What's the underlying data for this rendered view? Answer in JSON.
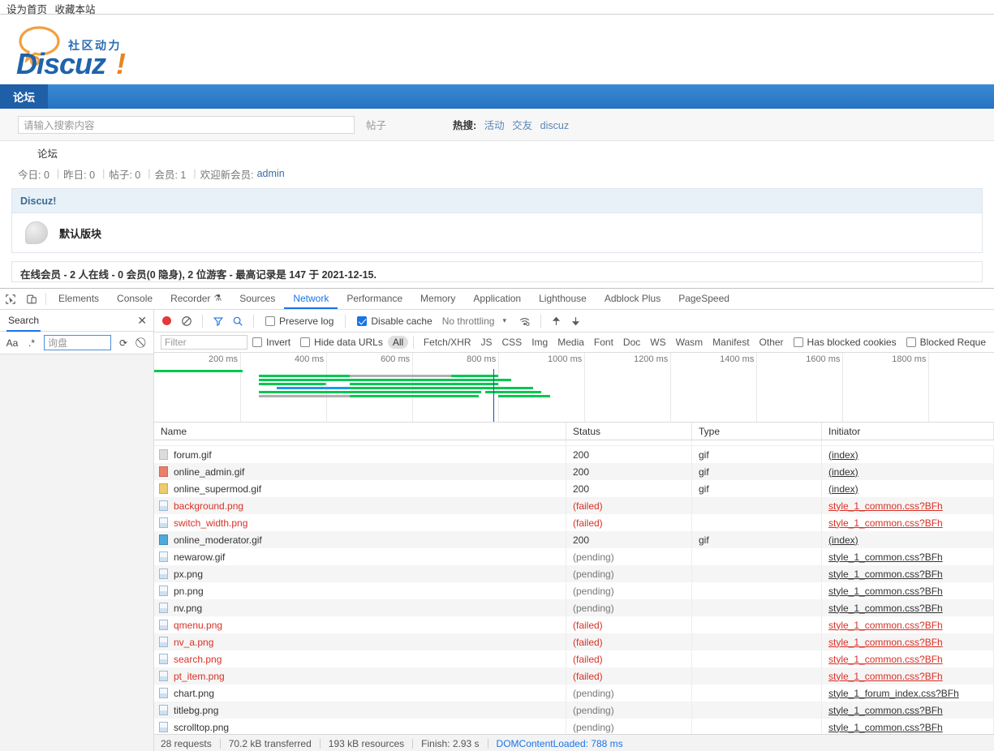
{
  "browser": {
    "topbar_links": [
      "设为首页",
      "收藏本站"
    ],
    "logo": {
      "tagline": "社区动力",
      "wordmark": "Discuz",
      "bang": "!"
    },
    "nav": {
      "tab": "论坛"
    },
    "search": {
      "placeholder": "请输入搜索内容",
      "scope": "帖子",
      "hot_label": "热搜:",
      "hot_links": [
        "活动",
        "交友",
        "discuz"
      ]
    },
    "breadcrumb": "论坛",
    "stats": {
      "today_label": "今日: 0",
      "yesterday_label": "昨日: 0",
      "posts_label": "帖子: 0",
      "members_label": "会员: 1",
      "welcome_label": "欢迎新会员:",
      "newest_member": "admin"
    },
    "forum_block": {
      "title": "Discuz!",
      "board_name": "默认版块"
    },
    "online_text": "在线会员 - 2 人在线 - 0 会员(0 隐身), 2 位游客 - 最高记录是 147 于 2021-12-15."
  },
  "devtools": {
    "tabs": [
      {
        "label": "Elements",
        "active": false
      },
      {
        "label": "Console",
        "active": false
      },
      {
        "label": "Recorder",
        "active": false,
        "badge": "⚗"
      },
      {
        "label": "Sources",
        "active": false
      },
      {
        "label": "Network",
        "active": true
      },
      {
        "label": "Performance",
        "active": false
      },
      {
        "label": "Memory",
        "active": false
      },
      {
        "label": "Application",
        "active": false
      },
      {
        "label": "Lighthouse",
        "active": false
      },
      {
        "label": "Adblock Plus",
        "active": false
      },
      {
        "label": "PageSpeed",
        "active": false
      }
    ],
    "search_panel": {
      "title": "Search",
      "close": "✕",
      "match_case": "Aa",
      "regex": ".*",
      "query": "询盘",
      "refresh_icon": "⟳",
      "clear_icon": "⃠"
    },
    "network_toolbar": {
      "record_title": "record",
      "clear_icon": "⃠",
      "filter_icon": "filter",
      "search_icon": "⌕",
      "preserve_log": {
        "label": "Preserve log",
        "checked": false
      },
      "disable_cache": {
        "label": "Disable cache",
        "checked": true
      },
      "throttling": "No throttling",
      "caret": "▾",
      "wifi_icon": "wifi",
      "import_icon": "⬆",
      "export_icon": "⬇"
    },
    "filter_bar": {
      "filter_placeholder": "Filter",
      "invert": {
        "label": "Invert",
        "checked": false
      },
      "hide_data_urls": {
        "label": "Hide data URLs",
        "checked": false
      },
      "types": [
        "All",
        "Fetch/XHR",
        "JS",
        "CSS",
        "Img",
        "Media",
        "Font",
        "Doc",
        "WS",
        "Wasm",
        "Manifest",
        "Other"
      ],
      "selected_type": "All",
      "has_blocked_cookies": {
        "label": "Has blocked cookies",
        "checked": false
      },
      "blocked_requests": {
        "label": "Blocked Reque",
        "checked": false
      }
    },
    "overview": {
      "ticks": [
        "200 ms",
        "400 ms",
        "600 ms",
        "800 ms",
        "1000 ms",
        "1200 ms",
        "1400 ms",
        "1600 ms",
        "1800 ms"
      ],
      "dcl_marker_ms": 788,
      "total_ms": 1950
    },
    "columns": [
      "Name",
      "Status",
      "Type",
      "Initiator"
    ],
    "requests": [
      {
        "name": "forum.gif",
        "status": "200",
        "type": "gif",
        "initiator": "(index)",
        "icon": "img-grey",
        "failed": false
      },
      {
        "name": "online_admin.gif",
        "status": "200",
        "type": "gif",
        "initiator": "(index)",
        "icon": "img-orange",
        "failed": false
      },
      {
        "name": "online_supermod.gif",
        "status": "200",
        "type": "gif",
        "initiator": "(index)",
        "icon": "img-yellow",
        "failed": false
      },
      {
        "name": "background.png",
        "status": "(failed)",
        "type": "",
        "initiator": "style_1_common.css?BFh",
        "icon": "img-png",
        "failed": true
      },
      {
        "name": "switch_width.png",
        "status": "(failed)",
        "type": "",
        "initiator": "style_1_common.css?BFh",
        "icon": "img-png",
        "failed": true
      },
      {
        "name": "online_moderator.gif",
        "status": "200",
        "type": "gif",
        "initiator": "(index)",
        "icon": "img-blue",
        "failed": false
      },
      {
        "name": "newarow.gif",
        "status": "(pending)",
        "type": "",
        "initiator": "style_1_common.css?BFh",
        "icon": "img-png",
        "failed": false
      },
      {
        "name": "px.png",
        "status": "(pending)",
        "type": "",
        "initiator": "style_1_common.css?BFh",
        "icon": "img-png",
        "failed": false
      },
      {
        "name": "pn.png",
        "status": "(pending)",
        "type": "",
        "initiator": "style_1_common.css?BFh",
        "icon": "img-png",
        "failed": false
      },
      {
        "name": "nv.png",
        "status": "(pending)",
        "type": "",
        "initiator": "style_1_common.css?BFh",
        "icon": "img-png",
        "failed": false
      },
      {
        "name": "qmenu.png",
        "status": "(failed)",
        "type": "",
        "initiator": "style_1_common.css?BFh",
        "icon": "img-png",
        "failed": true
      },
      {
        "name": "nv_a.png",
        "status": "(failed)",
        "type": "",
        "initiator": "style_1_common.css?BFh",
        "icon": "img-png",
        "failed": true
      },
      {
        "name": "search.png",
        "status": "(failed)",
        "type": "",
        "initiator": "style_1_common.css?BFh",
        "icon": "img-png",
        "failed": true
      },
      {
        "name": "pt_item.png",
        "status": "(failed)",
        "type": "",
        "initiator": "style_1_common.css?BFh",
        "icon": "img-png",
        "failed": true
      },
      {
        "name": "chart.png",
        "status": "(pending)",
        "type": "",
        "initiator": "style_1_forum_index.css?BFh",
        "icon": "img-png",
        "failed": false
      },
      {
        "name": "titlebg.png",
        "status": "(pending)",
        "type": "",
        "initiator": "style_1_common.css?BFh",
        "icon": "img-png",
        "failed": false
      },
      {
        "name": "scrolltop.png",
        "status": "(pending)",
        "type": "",
        "initiator": "style_1_common.css?BFh",
        "icon": "img-png",
        "failed": false
      }
    ],
    "status_bar": {
      "requests": "28 requests",
      "transferred": "70.2 kB transferred",
      "resources": "193 kB resources",
      "finish": "Finish: 2.93 s",
      "dom_content_loaded": "DOMContentLoaded: 788 ms"
    }
  },
  "colors": {
    "accent": "#1a73e8",
    "nav_blue": "#2f7ecb",
    "failed_red": "#d93025",
    "bar_green": "#00c752",
    "bar_blue": "#2196f3",
    "bar_grey": "#b0b0b0",
    "record_red": "#e5383b"
  }
}
